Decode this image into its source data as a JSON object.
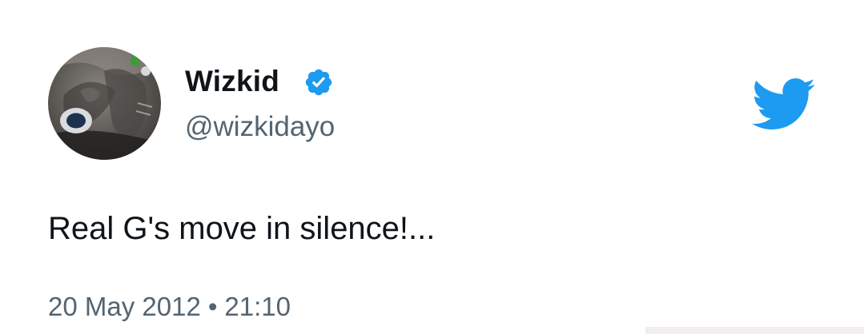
{
  "tweet": {
    "author": {
      "display_name": "Wizkid",
      "handle": "@wizkidayo",
      "verified": true
    },
    "text": "Real G's move in silence!...",
    "date": "20 May 2012",
    "separator": "•",
    "time": "21:10"
  },
  "icons": {
    "verified": "verified-badge-icon",
    "brand": "twitter-bird-icon"
  },
  "colors": {
    "text_primary": "#0f1419",
    "text_secondary": "#536471",
    "twitter_blue": "#1d9bf0"
  }
}
